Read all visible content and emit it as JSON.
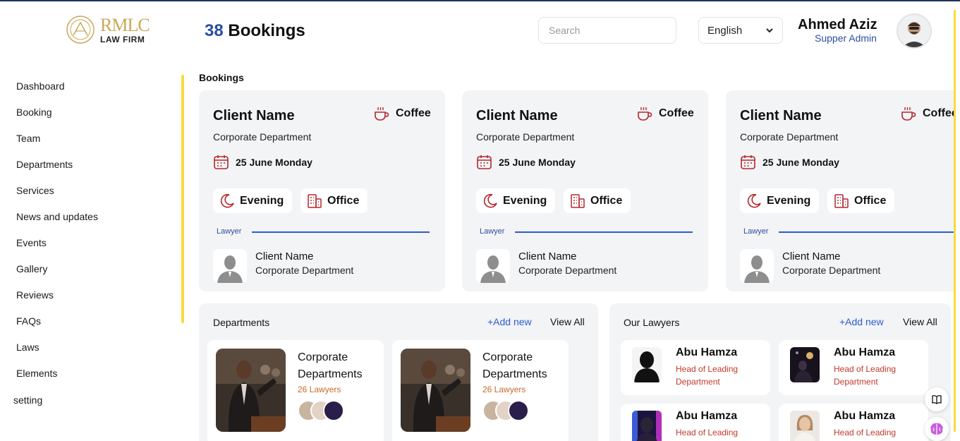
{
  "header": {
    "logo_monogram": "RMLC",
    "logo_firm": "LAW FIRM",
    "bookings_count": "38",
    "bookings_label": "Bookings",
    "search_placeholder": "Search",
    "language": "English",
    "user_name": "Ahmed Aziz",
    "user_role": "Supper Admin"
  },
  "sidebar": {
    "items": [
      {
        "label": "Dashboard"
      },
      {
        "label": "Booking"
      },
      {
        "label": "Team"
      },
      {
        "label": "Departments"
      },
      {
        "label": "Services"
      },
      {
        "label": "News and updates"
      },
      {
        "label": "Events"
      },
      {
        "label": "Gallery"
      },
      {
        "label": "Reviews"
      },
      {
        "label": "FAQs"
      },
      {
        "label": "Laws"
      },
      {
        "label": "Elements"
      }
    ],
    "setting": "setting"
  },
  "bookings": {
    "section_title": "Bookings",
    "cards": [
      {
        "client": "Client Name",
        "beverage": "Coffee",
        "department": "Corporate Department",
        "date": "25 June Monday",
        "time": "Evening",
        "location": "Office",
        "lawyer_label": "Lawyer",
        "lawyer_name": "Client Name",
        "lawyer_department": "Corporate Department"
      },
      {
        "client": "Client Name",
        "beverage": "Coffee",
        "department": "Corporate Department",
        "date": "25 June Monday",
        "time": "Evening",
        "location": "Office",
        "lawyer_label": "Lawyer",
        "lawyer_name": "Client Name",
        "lawyer_department": "Corporate Department"
      },
      {
        "client": "Client Name",
        "beverage": "Coffee",
        "department": "Corporate Department",
        "date": "25 June Monday",
        "time": "Evening",
        "location": "Office",
        "lawyer_label": "Lawyer",
        "lawyer_name": "Client Name",
        "lawyer_department": "Corporate Department"
      }
    ]
  },
  "departments": {
    "title": "Departments",
    "add_new": "+Add new",
    "view_all": "View All",
    "items": [
      {
        "title": "Corporate Departments",
        "count": "26 Lawyers"
      },
      {
        "title": "Corporate Departments",
        "count": "26 Lawyers"
      }
    ]
  },
  "lawyers": {
    "title": "Our Lawyers",
    "add_new": "+Add new",
    "view_all": "View All",
    "items": [
      {
        "name": "Abu Hamza",
        "role": "Head of Leading Department"
      },
      {
        "name": "Abu Hamza",
        "role": "Head of Leading Department"
      },
      {
        "name": "Abu Hamza",
        "role": "Head of Leading Department"
      },
      {
        "name": "Abu Hamza",
        "role": "Head of Leading Department"
      }
    ]
  },
  "colors": {
    "accent_blue": "#2b4ea2",
    "link_blue": "#2b5bd7",
    "scroll_yellow": "#f7dc3b",
    "icon_red": "#b3262d",
    "card_bg": "#f3f4f6",
    "logo_gold": "#c9a85a"
  },
  "icons": [
    "coffee-icon",
    "calendar-icon",
    "moon-icon",
    "building-icon",
    "user-silhouette-icon",
    "book-icon",
    "brain-icon",
    "chevron-down-icon"
  ]
}
